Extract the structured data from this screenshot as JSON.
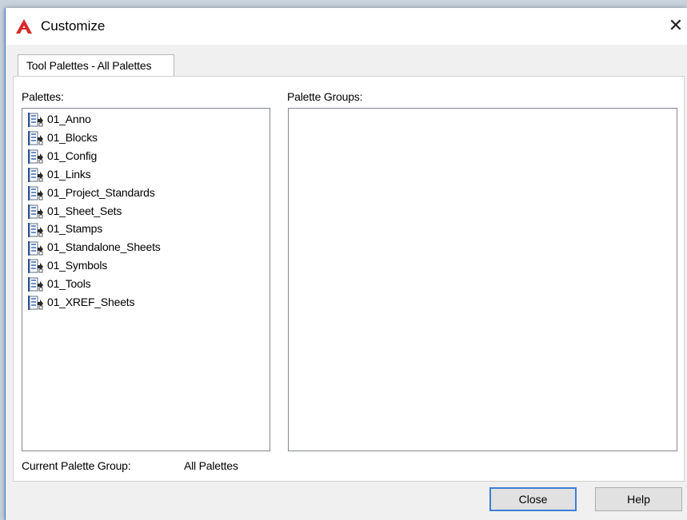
{
  "window": {
    "title": "Customize",
    "close_glyph": "✕"
  },
  "tabs": [
    {
      "label": "Tool Palettes - All Palettes",
      "selected": true
    }
  ],
  "palettes": {
    "label": "Palettes:",
    "items": [
      "01_Anno",
      "01_Blocks",
      "01_Config",
      "01_Links",
      "01_Project_Standards",
      "01_Sheet_Sets",
      "01_Stamps",
      "01_Standalone_Sheets",
      "01_Symbols",
      "01_Tools",
      "01_XREF_Sheets"
    ]
  },
  "palette_groups": {
    "label": "Palette Groups:"
  },
  "current_group": {
    "label": "Current Palette Group:",
    "value": "All Palettes"
  },
  "buttons": {
    "close": "Close",
    "help": "Help"
  },
  "colors": {
    "accent": "#3c7fd6",
    "app_icon_red": "#d9262b"
  }
}
